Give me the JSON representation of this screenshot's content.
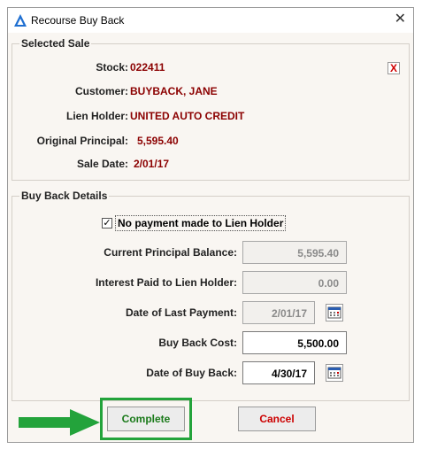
{
  "window": {
    "title": "Recourse Buy Back",
    "close_glyph": "✕",
    "icon": "app-triangle-icon"
  },
  "selected_sale": {
    "group_title": "Selected Sale",
    "stock_label": "Stock:",
    "stock_value": "022411",
    "customer_label": "Customer:",
    "customer_value": "BUYBACK, JANE",
    "lien_holder_label": "Lien Holder:",
    "lien_holder_value": "UNITED AUTO CREDIT",
    "original_principal_label": "Original Principal:",
    "original_principal_value": "5,595.40",
    "sale_date_label": "Sale Date:",
    "sale_date_value": "2/01/17",
    "clear_glyph": "X"
  },
  "buy_back": {
    "group_title": "Buy Back Details",
    "no_payment_label": "No payment made to Lien Holder",
    "no_payment_checked": true,
    "current_principal_label": "Current Principal Balance:",
    "current_principal_value": "5,595.40",
    "interest_paid_label": "Interest Paid to Lien Holder:",
    "interest_paid_value": "0.00",
    "last_payment_label": "Date of Last Payment:",
    "last_payment_value": "2/01/17",
    "buy_back_cost_label": "Buy Back Cost:",
    "buy_back_cost_value": "5,500.00",
    "buy_back_date_label": "Date of Buy Back:",
    "buy_back_date_value": "4/30/17"
  },
  "buttons": {
    "complete": "Complete",
    "cancel": "Cancel"
  },
  "colors": {
    "value_text": "#8b0000",
    "complete_text": "#1a7a1a",
    "cancel_text": "#cc0000",
    "highlight": "#23a33b"
  }
}
